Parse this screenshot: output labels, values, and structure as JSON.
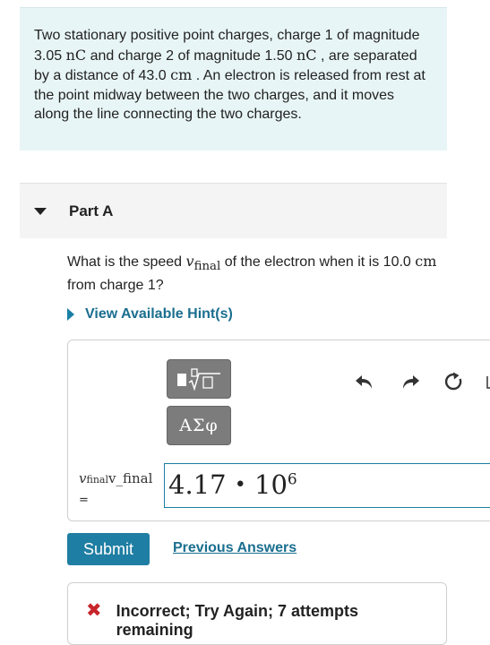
{
  "problem": {
    "t1": "Two stationary positive point charges, charge 1 of magnitude 3.05 ",
    "u1": "nC",
    "t2": " and charge 2 of magnitude 1.50 ",
    "u2": "nC",
    "t3": " , are separated by a distance of 43.0 ",
    "u3": "cm",
    "t4": " . An electron is released from rest at the point midway between the two charges, and it moves along the line connecting the two charges."
  },
  "part": {
    "title": "Part A"
  },
  "question": {
    "t1": "What is the speed ",
    "var": "v",
    "sub": "final",
    "t2": " of the electron when it is 10.0 ",
    "unit": "cm",
    "t3": " from charge 1?"
  },
  "hint": {
    "label": "View Available Hint(s)"
  },
  "toolbar": {
    "templates_icon": "sqrt-template-icon",
    "greek_label": "ΑΣφ",
    "undo_icon": "undo-icon",
    "redo_icon": "redo-icon",
    "reset_icon": "reset-icon"
  },
  "answer": {
    "var": "v",
    "sub": "final",
    "raw": "v_final",
    "equals": "=",
    "mantissa": "4.17",
    "dot": "•",
    "base": "10",
    "exp": "6"
  },
  "actions": {
    "submit": "Submit",
    "previous": "Previous Answers"
  },
  "feedback": {
    "icon": "x-icon",
    "text": "Incorrect; Try Again; 7 attempts remaining"
  },
  "colors": {
    "accent": "#1f7ea3",
    "link": "#1a6e8f",
    "error": "#c8252c",
    "problem_bg": "#e8f5f6"
  }
}
